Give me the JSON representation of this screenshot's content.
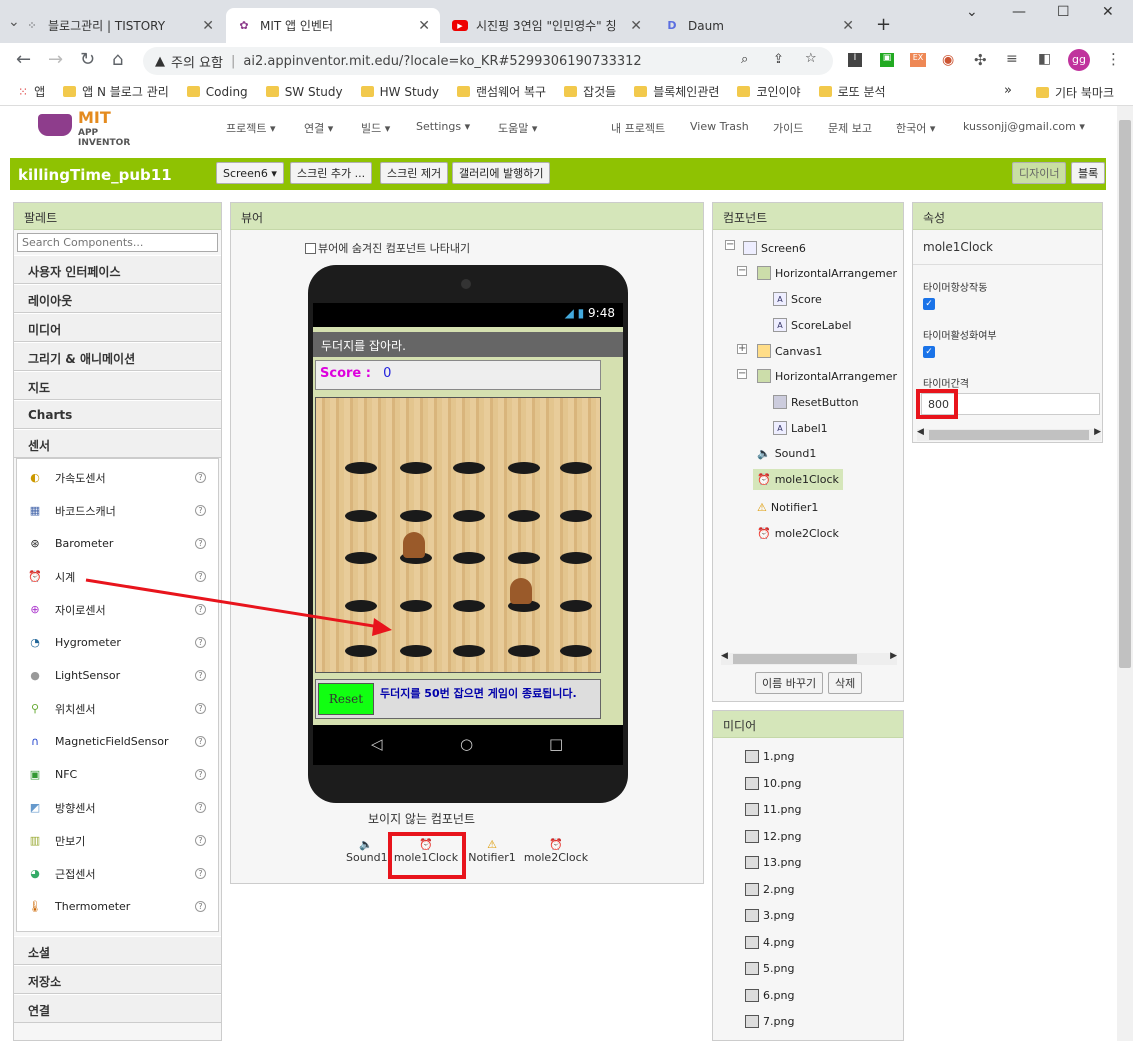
{
  "browser": {
    "tabs": [
      {
        "title": "블로그관리 | TISTORY"
      },
      {
        "title": "MIT 앱 인벤터"
      },
      {
        "title": "시진핑 3연임 \"인민영수\" 칭"
      },
      {
        "title": "Daum"
      }
    ],
    "security": "주의 요함",
    "url": "ai2.appinventor.mit.edu/?locale=ko_KR#5299306190733312",
    "profile": "gg",
    "bookmarks": [
      "앱",
      "앱 N 블로그 관리",
      "Coding",
      "SW Study",
      "HW Study",
      "랜섬웨어 복구",
      "잡것들",
      "블록체인관련",
      "코인이야",
      "로또 분석"
    ],
    "other_bookmarks": "기타 북마크"
  },
  "app": {
    "logo_top": "MIT",
    "logo_bottom": "APP INVENTOR",
    "menus": [
      "프로젝트 ▾",
      "연결 ▾",
      "빌드 ▾",
      "Settings ▾",
      "도움말 ▾"
    ],
    "right_menus": [
      "내 프로젝트",
      "View Trash",
      "가이드",
      "문제 보고",
      "한국어 ▾",
      "kussonjj@gmail.com ▾"
    ],
    "project_name": "killingTime_pub11",
    "screen_select": "Screen6 ▾",
    "add_screen": "스크린 추가 ...",
    "remove_screen": "스크린 제거",
    "publish_gallery": "갤러리에 발행하기",
    "designer": "디자이너",
    "blocks": "블록"
  },
  "palette": {
    "title": "팔레트",
    "search_placeholder": "Search Components...",
    "categories_top": [
      "사용자 인터페이스",
      "레이아웃",
      "미디어",
      "그리기 & 애니메이션",
      "지도",
      "Charts",
      "센서"
    ],
    "sensors": [
      "가속도센서",
      "바코드스캐너",
      "Barometer",
      "시계",
      "자이로센서",
      "Hygrometer",
      "LightSensor",
      "위치센서",
      "MagneticFieldSensor",
      "NFC",
      "방향센서",
      "만보기",
      "근접센서",
      "Thermometer"
    ],
    "categories_bottom": [
      "소셜",
      "저장소",
      "연결"
    ]
  },
  "viewer": {
    "title": "뷰어",
    "show_hidden": "뷰어에 숨겨진 컴포넌트 나타내기",
    "time": "9:48",
    "screen_title": "두더지를 잡아라.",
    "score_label": "Score :",
    "score_value": "0",
    "reset_button": "Reset",
    "message": "두더지를 50번 잡으면 게임이 종료됩니다.",
    "nonvisible_title": "보이지 않는 컴포넌트",
    "nonvisible": [
      "Sound1",
      "mole1Clock",
      "Notifier1",
      "mole2Clock"
    ]
  },
  "components": {
    "title": "컴포넌트",
    "tree": [
      "Screen6",
      "HorizontalArrangemer",
      "Score",
      "ScoreLabel",
      "Canvas1",
      "HorizontalArrangemer",
      "ResetButton",
      "Label1",
      "Sound1",
      "mole1Clock",
      "Notifier1",
      "mole2Clock"
    ],
    "rename": "이름 바꾸기",
    "delete": "삭제"
  },
  "media": {
    "title": "미디어",
    "files": [
      "1.png",
      "10.png",
      "11.png",
      "12.png",
      "13.png",
      "2.png",
      "3.png",
      "4.png",
      "5.png",
      "6.png",
      "7.png"
    ]
  },
  "properties": {
    "title": "속성",
    "component": "mole1Clock",
    "timer_always_fires": "타이머항상작동",
    "timer_enabled": "타이머활성화여부",
    "timer_interval_label": "타이머간격",
    "timer_interval_value": "800"
  },
  "colors": {
    "accent": "#8fc202",
    "highlight": "#e8141c",
    "panel_head": "#d5e6ba"
  }
}
